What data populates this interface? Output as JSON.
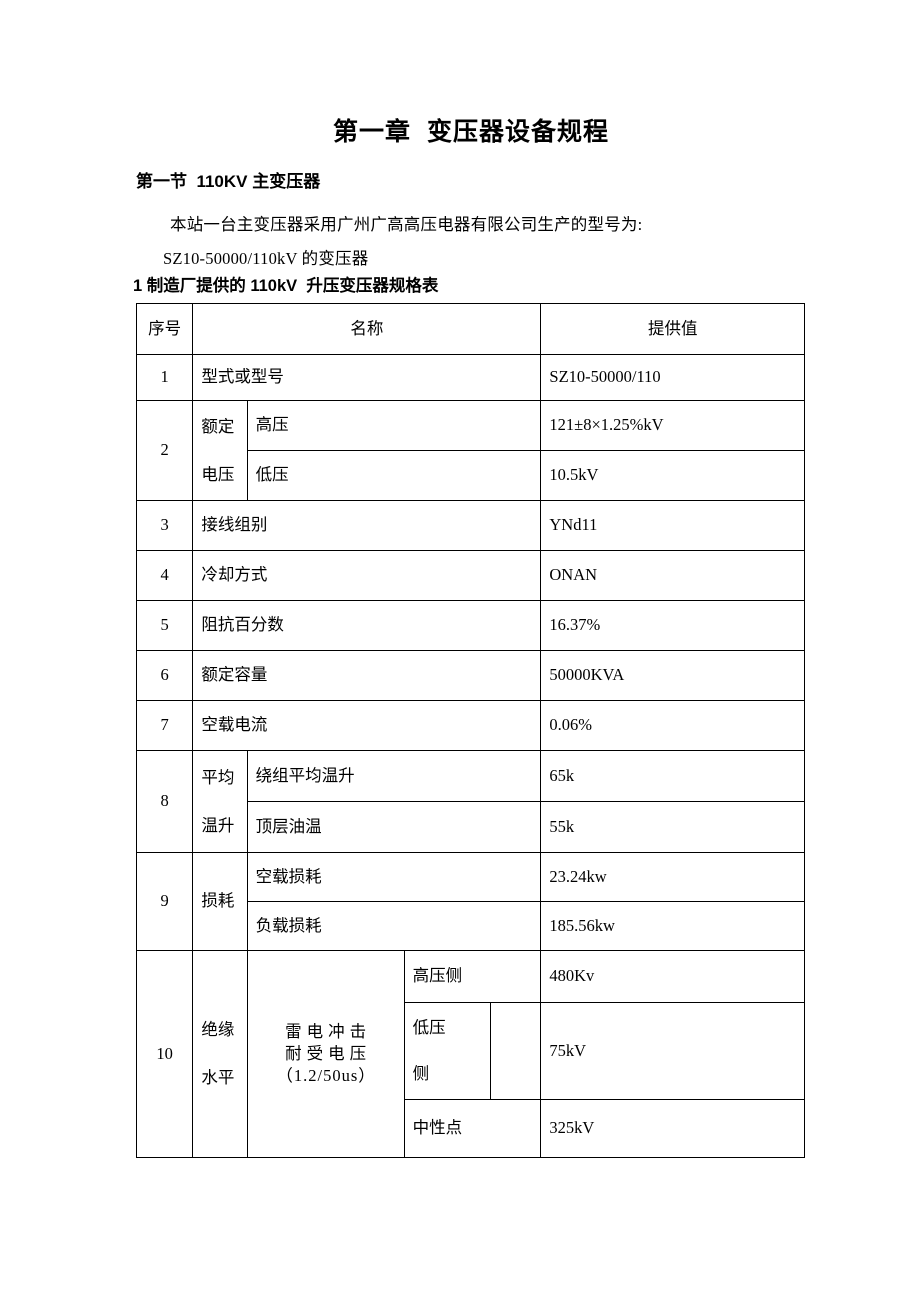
{
  "document": {
    "title": "第一章  变压器设备规程",
    "section_heading": "第一节  110KV 主变压器",
    "body_line_1": "本站一台主变压器采用广州广高高压电器有限公司生产的型号为:",
    "body_line_2": "SZ10-50000/110kV 的变压器",
    "table_caption": "1 制造厂提供的 110kV  升压变压器规格表"
  },
  "table": {
    "headers": {
      "index": "序号",
      "name": "名称",
      "value": "提供值"
    },
    "rows": [
      {
        "index": "1",
        "name": "型式或型号",
        "value": "SZ10-50000/110"
      },
      {
        "index": "2",
        "group_label_line1": "额定",
        "group_label_line2": "电压",
        "sub": [
          {
            "label": "高压",
            "value": "121±8×1.25%kV"
          },
          {
            "label": "低压",
            "value": "10.5kV"
          }
        ]
      },
      {
        "index": "3",
        "name": "接线组别",
        "value": "YNd11"
      },
      {
        "index": "4",
        "name": "冷却方式",
        "value": "ONAN"
      },
      {
        "index": "5",
        "name": "阻抗百分数",
        "value": "16.37%"
      },
      {
        "index": "6",
        "name": "额定容量",
        "value": "50000KVA"
      },
      {
        "index": "7",
        "name": "空载电流",
        "value": "0.06%"
      },
      {
        "index": "8",
        "group_label_line1": "平均",
        "group_label_line2": "温升",
        "sub": [
          {
            "label": "绕组平均温升",
            "value": "65k"
          },
          {
            "label": "顶层油温",
            "value": "55k"
          }
        ]
      },
      {
        "index": "9",
        "group_label": "损耗",
        "sub": [
          {
            "label": "空载损耗",
            "value": "23.24kw"
          },
          {
            "label": "负载损耗",
            "value": "185.56kw"
          }
        ]
      },
      {
        "index": "10",
        "group_label_line1": "绝缘",
        "group_label_line2": "水平",
        "impulse_line1": "雷电冲击",
        "impulse_line2": "耐受电压",
        "impulse_line3": "（1.2/50us）",
        "sub": [
          {
            "label": "高压侧",
            "value": "480Kv"
          },
          {
            "label_line1": "低压",
            "label_line2": "侧",
            "extra": "",
            "value": "75kV"
          },
          {
            "label": "中性点",
            "value": "325kV"
          }
        ]
      }
    ]
  }
}
